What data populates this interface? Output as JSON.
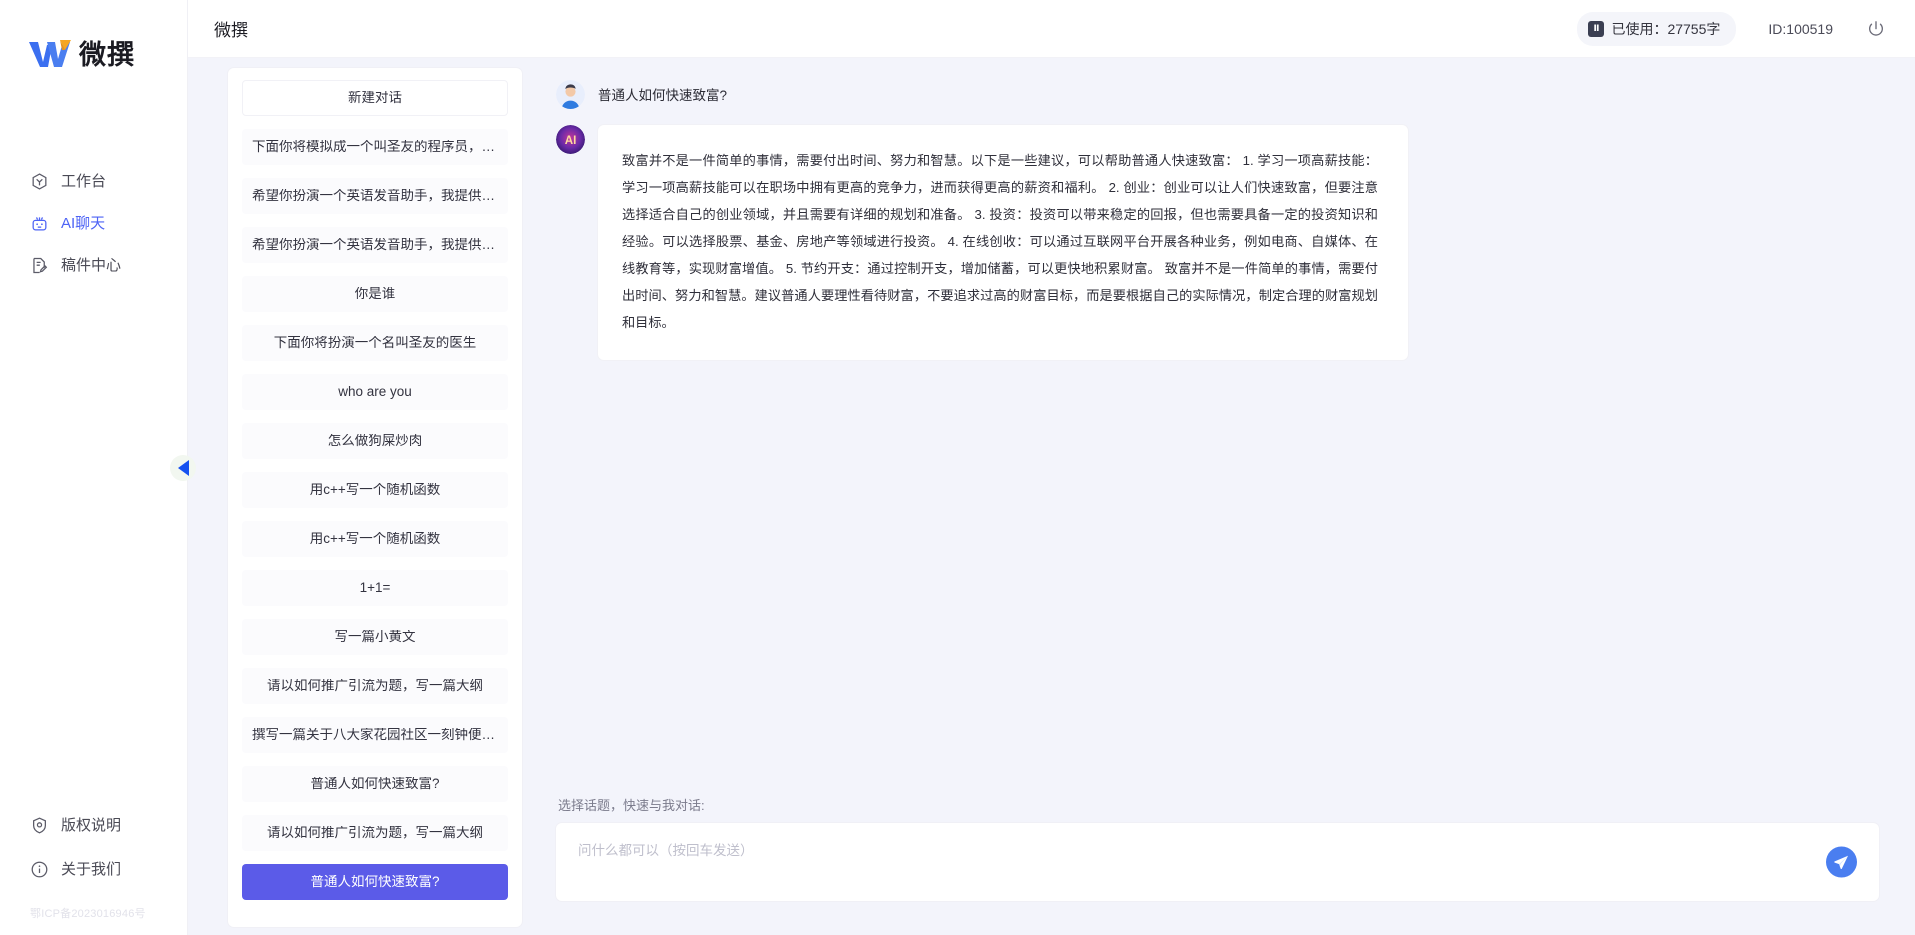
{
  "brand": {
    "logo_text": "微撰",
    "logo_icon": "w-logo-icon"
  },
  "nav": {
    "items": [
      {
        "label": "工作台",
        "icon": "workbench-icon",
        "active": false
      },
      {
        "label": "AI聊天",
        "icon": "robot-icon",
        "active": true
      },
      {
        "label": "稿件中心",
        "icon": "document-edit-icon",
        "active": false
      }
    ],
    "bottom_items": [
      {
        "label": "版权说明",
        "icon": "shield-icon"
      },
      {
        "label": "关于我们",
        "icon": "info-icon"
      }
    ],
    "icp": "鄂ICP备2023016946号"
  },
  "collapse_handle": {
    "icon": "chevron-left-icon"
  },
  "topbar": {
    "title": "微撰",
    "usage_label": "已使用：27755字",
    "usage_icon": "counter-icon",
    "user_id": "ID:100519",
    "power_icon": "power-icon"
  },
  "conversations": {
    "new_chat_label": "新建对话",
    "items": [
      {
        "label": "下面你将模拟成一个叫圣友的程序员，我说...",
        "active": false
      },
      {
        "label": "希望你扮演一个英语发音助手，我提供给你...",
        "active": false
      },
      {
        "label": "希望你扮演一个英语发音助手，我提供给你...",
        "active": false
      },
      {
        "label": "你是谁",
        "active": false
      },
      {
        "label": "下面你将扮演一个名叫圣友的医生",
        "active": false
      },
      {
        "label": "who are you",
        "active": false
      },
      {
        "label": "怎么做狗屎炒肉",
        "active": false
      },
      {
        "label": "用c++写一个随机函数",
        "active": false
      },
      {
        "label": "用c++写一个随机函数",
        "active": false
      },
      {
        "label": "1+1=",
        "active": false
      },
      {
        "label": "写一篇小黄文",
        "active": false
      },
      {
        "label": "请以如何推广引流为题，写一篇大纲",
        "active": false
      },
      {
        "label": "撰写一篇关于八大家花园社区一刻钟便民生...",
        "active": false
      },
      {
        "label": "普通人如何快速致富?",
        "active": false
      },
      {
        "label": "请以如何推广引流为题，写一篇大纲",
        "active": false
      },
      {
        "label": "普通人如何快速致富?",
        "active": true
      }
    ]
  },
  "chat": {
    "user_message": "普通人如何快速致富?",
    "user_avatar_icon": "user-avatar-icon",
    "ai_avatar_icon": "ai-avatar-icon",
    "ai_message": "致富并不是一件简单的事情，需要付出时间、努力和智慧。以下是一些建议，可以帮助普通人快速致富： 1. 学习一项高薪技能：学习一项高薪技能可以在职场中拥有更高的竞争力，进而获得更高的薪资和福利。 2. 创业：创业可以让人们快速致富，但要注意选择适合自己的创业领域，并且需要有详细的规划和准备。 3. 投资：投资可以带来稳定的回报，但也需要具备一定的投资知识和经验。可以选择股票、基金、房地产等领域进行投资。 4. 在线创收：可以通过互联网平台开展各种业务，例如电商、自媒体、在线教育等，实现财富增值。 5. 节约开支：通过控制开支，增加储蓄，可以更快地积累财富。 致富并不是一件简单的事情，需要付出时间、努力和智慧。建议普通人要理性看待财富，不要追求过高的财富目标，而是要根据自己的实际情况，制定合理的财富规划和目标。"
  },
  "composer": {
    "topic_hint": "选择话题，快速与我对话:",
    "placeholder": "问什么都可以（按回车发送）",
    "send_icon": "send-plane-icon"
  },
  "colors": {
    "accent": "#5b5be8",
    "nav_active": "#4d63f5",
    "send_button": "#4a7ef0",
    "page_bg": "#f3f4fb",
    "panel_bg": "#ffffff"
  }
}
